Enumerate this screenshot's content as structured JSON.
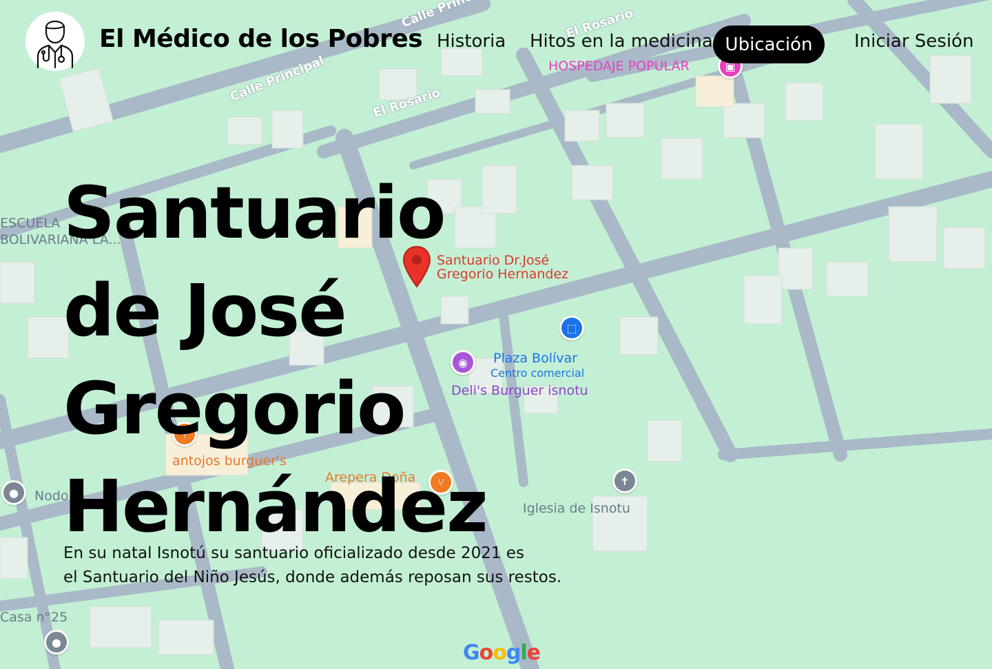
{
  "brand": {
    "name": "El Médico de los Pobres",
    "logo_icon": "doctor-icon"
  },
  "nav": {
    "items": [
      {
        "label": "Historia"
      },
      {
        "label": "Hitos en la medicina"
      },
      {
        "label": "Ubicación",
        "active": true
      },
      {
        "label": "Iniciar Sesión"
      }
    ]
  },
  "hero": {
    "title_lines": [
      "Santuario",
      "de José",
      "Gregorio",
      "Hernández"
    ],
    "description_line1": "En su natal Isnotú su santuario oficializado desde 2021 es",
    "description_line2": "el Santuario del Niño Jesús, donde además reposan sus restos."
  },
  "map": {
    "labels": {
      "calle_principal": "Calle Principal",
      "calle_principal_top": "Calle Princ",
      "el_rosario": "El Rosario",
      "el_rosario_top": "El Rosario",
      "hospedaje": "HOSPEDAJE POPULAR",
      "escuela_1": "ESCUELA",
      "escuela_2": "BOLIVARIANA LA...",
      "santuario_1": "Santuario Dr.José",
      "santuario_2": "Gregorio Hernandez",
      "plaza": "Plaza Bolívar",
      "centro": "Centro comercial",
      "delis": "Deli's Burguer isnotu",
      "antojos": "antojos burguer's",
      "arepera": "Arepera Doña",
      "nodo": "Nodo",
      "iglesia": "Iglesia de Isnotu",
      "casa": "Casa n°25",
      "google": "Google"
    },
    "colors": {
      "background": "#c3f0d4",
      "road": "#a9b9c8",
      "building": "#e6efe9",
      "pin_red": "#e8322a"
    }
  }
}
